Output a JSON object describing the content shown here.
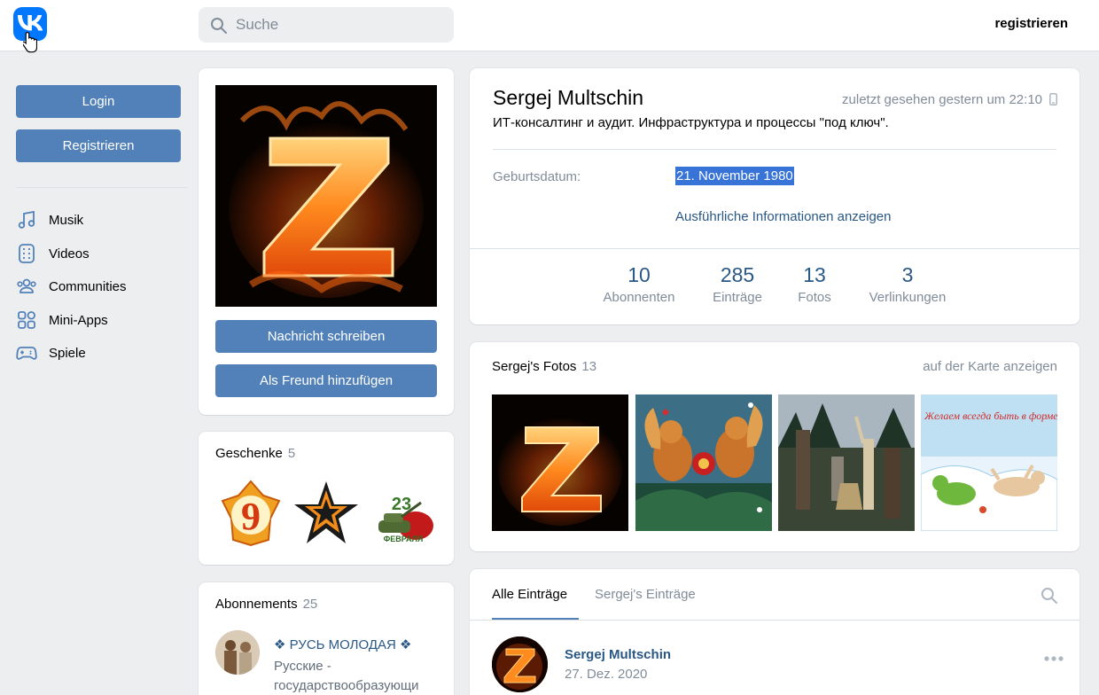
{
  "header": {
    "search_placeholder": "Suche",
    "register_link": "registrieren"
  },
  "sidebar": {
    "login_label": "Login",
    "register_label": "Registrieren",
    "menu": [
      {
        "label": "Musik",
        "icon": "music-icon"
      },
      {
        "label": "Videos",
        "icon": "video-icon"
      },
      {
        "label": "Communities",
        "icon": "users-icon"
      },
      {
        "label": "Mini-Apps",
        "icon": "apps-icon"
      },
      {
        "label": "Spiele",
        "icon": "gamepad-icon"
      }
    ]
  },
  "profile_actions": {
    "message_button": "Nachricht schreiben",
    "add_friend_button": "Als Freund hinzufügen"
  },
  "gifts": {
    "title": "Geschenke",
    "count": "5"
  },
  "subscriptions": {
    "title": "Abonnements",
    "count": "25",
    "items": [
      {
        "name": "❖ РУСЬ МОЛОДАЯ ❖",
        "description": "Русские - государствообразующи"
      }
    ]
  },
  "profile": {
    "name": "Sergej Multschin",
    "last_seen": "zuletzt gesehen gestern um 22:10",
    "status": "ИТ-консалтинг и аудит. Инфраструктура и процессы \"под ключ\".",
    "birthday_label": "Geburtsdatum:",
    "birthday_value": "21. November 1980",
    "more_info": "Ausführliche Informationen anzeigen",
    "stats": [
      {
        "value": "10",
        "label": "Abonnenten"
      },
      {
        "value": "285",
        "label": "Einträge"
      },
      {
        "value": "13",
        "label": "Fotos"
      },
      {
        "value": "3",
        "label": "Verlinkungen"
      }
    ]
  },
  "photos": {
    "title": "Sergej's Fotos",
    "count": "13",
    "map_link": "auf der Karte anzeigen"
  },
  "wall": {
    "tabs": [
      "Alle Einträge",
      "Sergej's Einträge"
    ],
    "post": {
      "author": "Sergej Multschin",
      "date": "27. Dez. 2020"
    }
  },
  "colors": {
    "accent": "#5181b8",
    "link": "#2a5885",
    "muted": "#818c99",
    "background": "#edeef0",
    "brand": "#0077ff",
    "selection": "#3874d8"
  }
}
